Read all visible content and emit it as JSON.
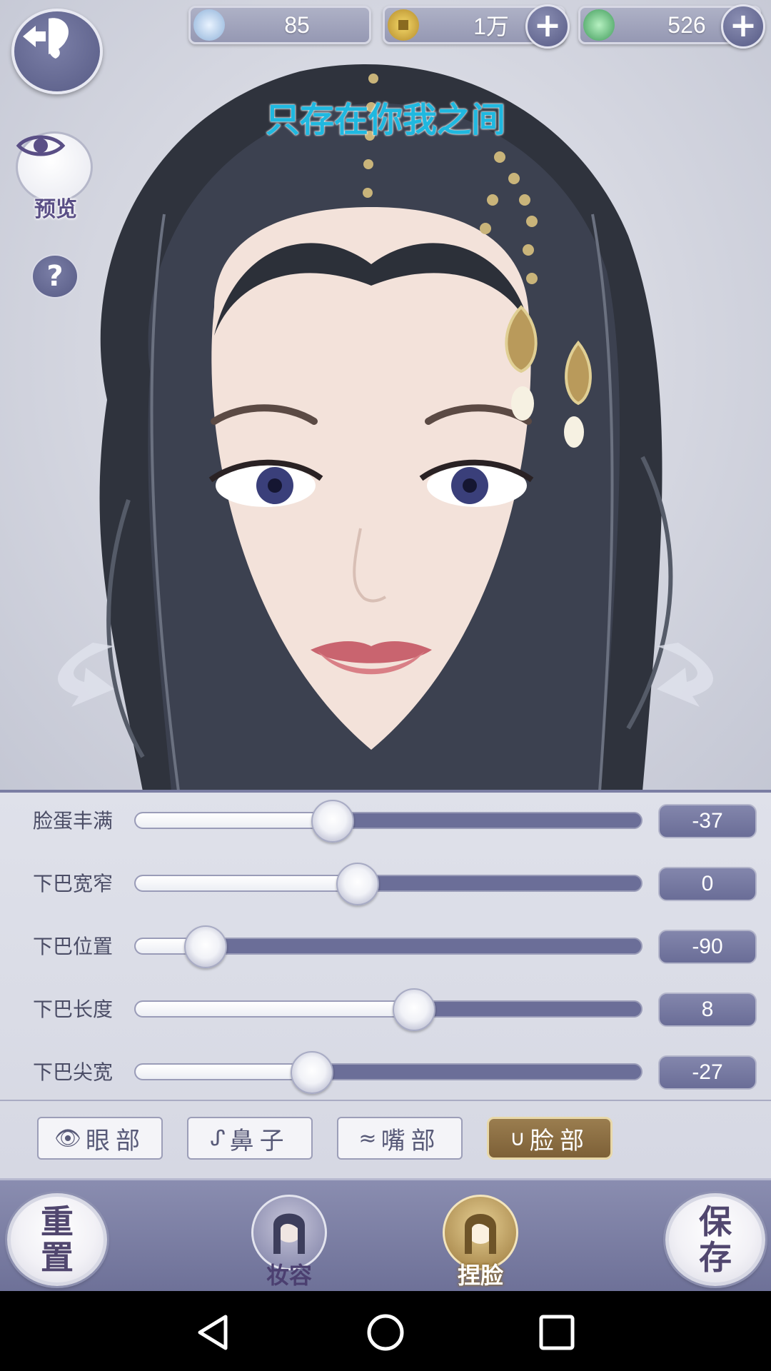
{
  "currency": [
    {
      "icon": "jade-orb-icon",
      "value": "85",
      "has_plus": false
    },
    {
      "icon": "copper-coin-icon",
      "value": "1万",
      "has_plus": true
    },
    {
      "icon": "green-dragon-icon",
      "value": "526",
      "has_plus": true
    }
  ],
  "caption": "只存在你我之间",
  "side_buttons": {
    "preview_label": "预览",
    "help_label": "?"
  },
  "sliders": [
    {
      "label": "脸蛋丰满",
      "value": "-37",
      "level": 0.39
    },
    {
      "label": "下巴宽窄",
      "value": "0",
      "level": 0.44
    },
    {
      "label": "下巴位置",
      "value": "-90",
      "level": 0.14
    },
    {
      "label": "下巴长度",
      "value": "8",
      "level": 0.55
    },
    {
      "label": "下巴尖宽",
      "value": "-27",
      "level": 0.35
    }
  ],
  "tabs": [
    {
      "label": "眼部",
      "icon": "eye-icon",
      "active": false
    },
    {
      "label": "鼻子",
      "icon": "nose-icon",
      "active": false
    },
    {
      "label": "嘴部",
      "icon": "mouth-icon",
      "active": false
    },
    {
      "label": "脸部",
      "icon": "face-icon",
      "active": true
    }
  ],
  "bottom": {
    "reset_label": "重置",
    "makeup_label": "妆容",
    "face_label": "捏脸",
    "save_label": "保存"
  },
  "colors": {
    "accent_purple": "#6b6e98",
    "gold_active": "#8a6d42",
    "caption_cyan": "#1fb8e0"
  }
}
